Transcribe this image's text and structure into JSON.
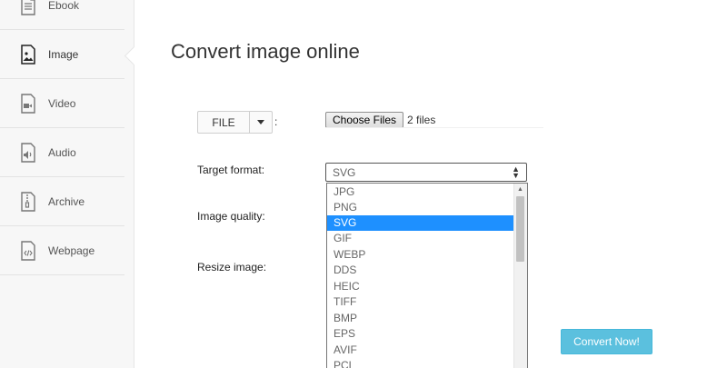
{
  "sidebar": {
    "items": [
      {
        "label": "Ebook",
        "icon": "ebook-icon"
      },
      {
        "label": "Image",
        "icon": "image-icon",
        "active": true
      },
      {
        "label": "Video",
        "icon": "video-icon"
      },
      {
        "label": "Audio",
        "icon": "audio-icon"
      },
      {
        "label": "Archive",
        "icon": "archive-icon"
      },
      {
        "label": "Webpage",
        "icon": "webpage-icon"
      }
    ]
  },
  "main": {
    "title": "Convert image online",
    "file": {
      "button_label": "FILE",
      "colon": ":",
      "choose_label": "Choose Files",
      "files_count": "2 files"
    },
    "target_format": {
      "label": "Target format:",
      "selected": "SVG",
      "options": [
        "JPG",
        "PNG",
        "SVG",
        "GIF",
        "WEBP",
        "DDS",
        "HEIC",
        "TIFF",
        "BMP",
        "EPS",
        "AVIF",
        "PCL"
      ]
    },
    "image_quality": {
      "label": "Image quality:"
    },
    "resize_image": {
      "label": "Resize image:"
    },
    "convert_label": "Convert Now!"
  },
  "colors": {
    "accent": "#5bc0de",
    "selection": "#1e90ff",
    "sidebar_bg": "#f7f7f7"
  }
}
